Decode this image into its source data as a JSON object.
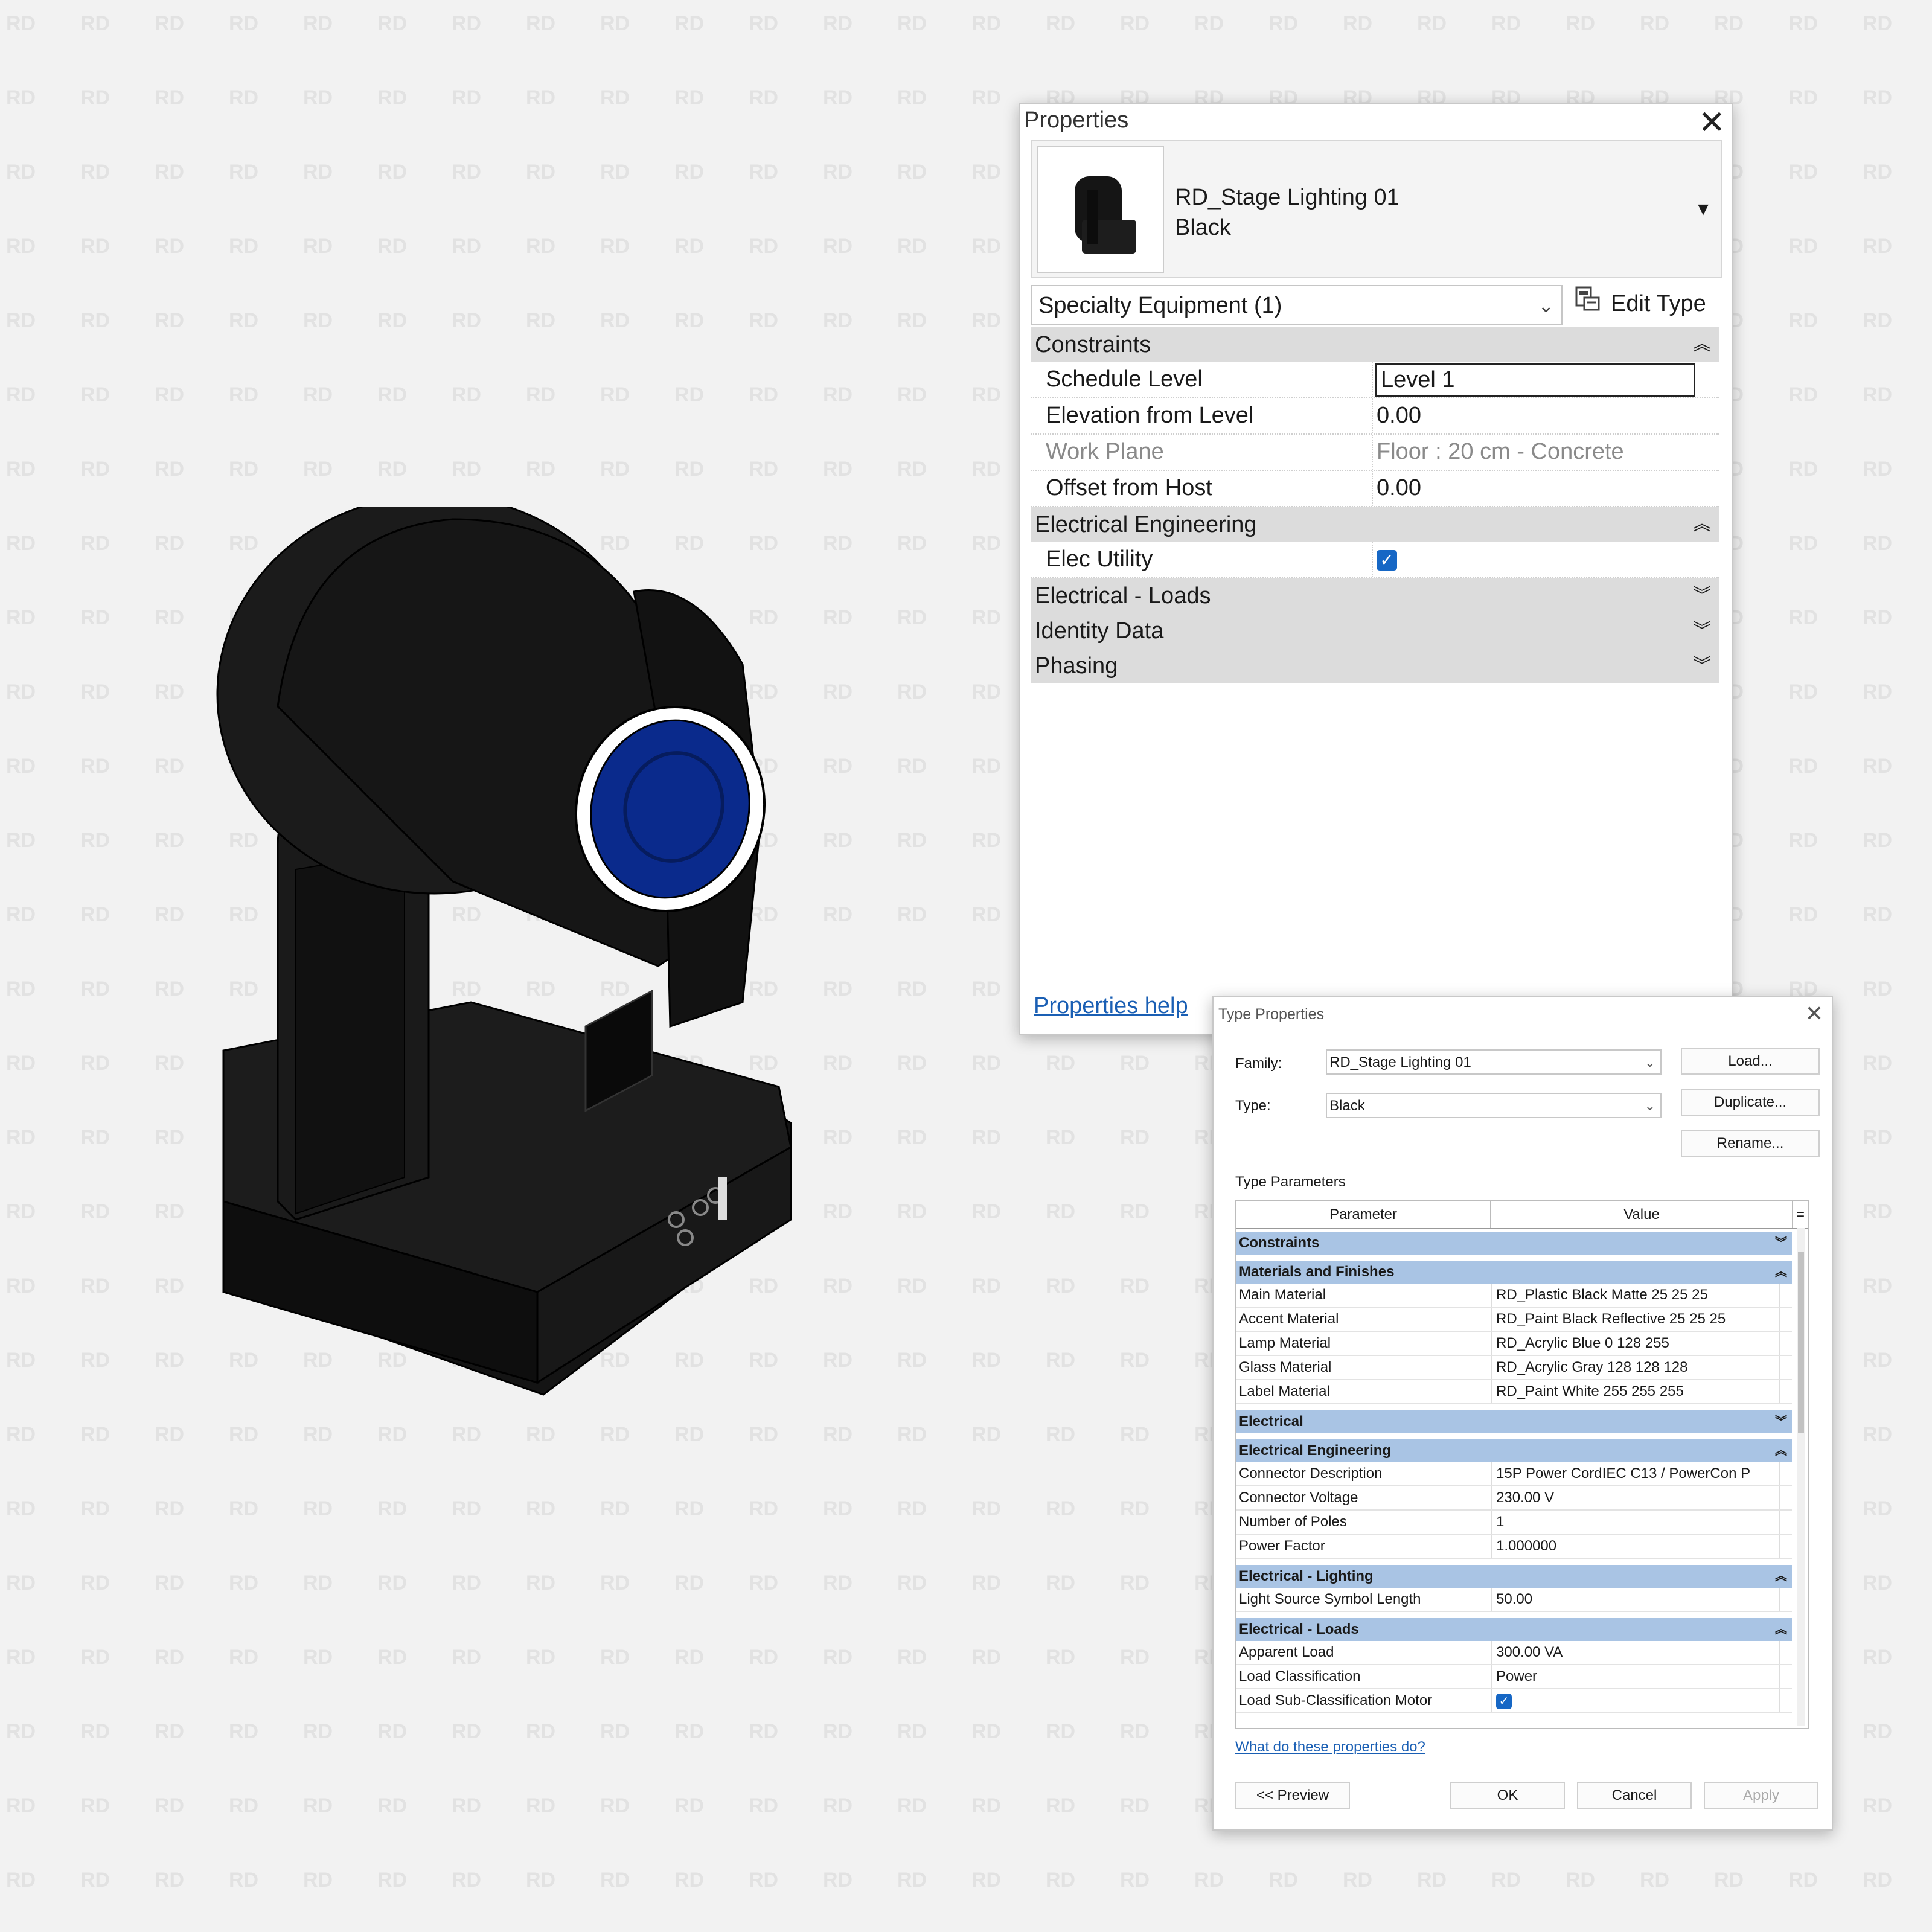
{
  "watermark": "RD",
  "properties": {
    "title": "Properties",
    "family_name": "RD_Stage Lighting 01",
    "type_name": "Black",
    "category_selector": "Specialty Equipment (1)",
    "edit_type_label": "Edit Type",
    "groups": [
      {
        "name": "Constraints",
        "expanded": true,
        "rows": [
          {
            "label": "Schedule Level",
            "value": "Level 1"
          },
          {
            "label": "Elevation from Level",
            "value": "0.00"
          },
          {
            "label": "Work Plane",
            "value": "Floor : 20 cm - Concrete"
          },
          {
            "label": "Offset from Host",
            "value": "0.00"
          }
        ]
      },
      {
        "name": "Electrical Engineering",
        "expanded": true,
        "rows": [
          {
            "label": "Elec Utility",
            "checked": true
          }
        ]
      },
      {
        "name": "Electrical - Loads",
        "expanded": false
      },
      {
        "name": "Identity Data",
        "expanded": false
      },
      {
        "name": "Phasing",
        "expanded": false
      }
    ],
    "help_link": "Properties help"
  },
  "type_properties": {
    "title": "Type Properties",
    "family_label": "Family:",
    "family_value": "RD_Stage Lighting 01",
    "type_label": "Type:",
    "type_value": "Black",
    "load_button": "Load...",
    "duplicate_button": "Duplicate...",
    "rename_button": "Rename...",
    "section_label": "Type Parameters",
    "col_parameter": "Parameter",
    "col_value": "Value",
    "col_eq": "=",
    "groups": [
      {
        "name": "Constraints",
        "rows": []
      },
      {
        "name": "Materials and Finishes",
        "rows": [
          {
            "p": "Main Material",
            "v": "RD_Plastic Black Matte 25 25 25"
          },
          {
            "p": "Accent Material",
            "v": "RD_Paint Black Reflective 25 25 25"
          },
          {
            "p": "Lamp Material",
            "v": "RD_Acrylic Blue 0 128 255"
          },
          {
            "p": "Glass Material",
            "v": "RD_Acrylic Gray 128 128 128"
          },
          {
            "p": "Label Material",
            "v": "RD_Paint White 255 255 255"
          }
        ]
      },
      {
        "name": "Electrical",
        "rows": []
      },
      {
        "name": "Electrical Engineering",
        "rows": [
          {
            "p": "Connector Description",
            "v": "15P Power CordIEC C13 / PowerCon P"
          },
          {
            "p": "Connector Voltage",
            "v": "230.00 V"
          },
          {
            "p": "Number of Poles",
            "v": "1"
          },
          {
            "p": "Power Factor",
            "v": "1.000000"
          }
        ]
      },
      {
        "name": "Electrical - Lighting",
        "rows": [
          {
            "p": "Light Source Symbol Length",
            "v": "50.00"
          }
        ]
      },
      {
        "name": "Electrical - Loads",
        "rows": [
          {
            "p": "Apparent Load",
            "v": "300.00 VA"
          },
          {
            "p": "Load Classification",
            "v": "Power"
          },
          {
            "p": "Load Sub-Classification Motor",
            "checked": true
          }
        ]
      }
    ],
    "help_link": "What do these properties do?",
    "preview_button": "<< Preview",
    "ok_button": "OK",
    "cancel_button": "Cancel",
    "apply_button": "Apply"
  },
  "colors": {
    "lens": "#0a2a8c",
    "group_header_blue": "#a9c4e4",
    "link": "#1a5fb4",
    "checkbox": "#1667c5"
  }
}
